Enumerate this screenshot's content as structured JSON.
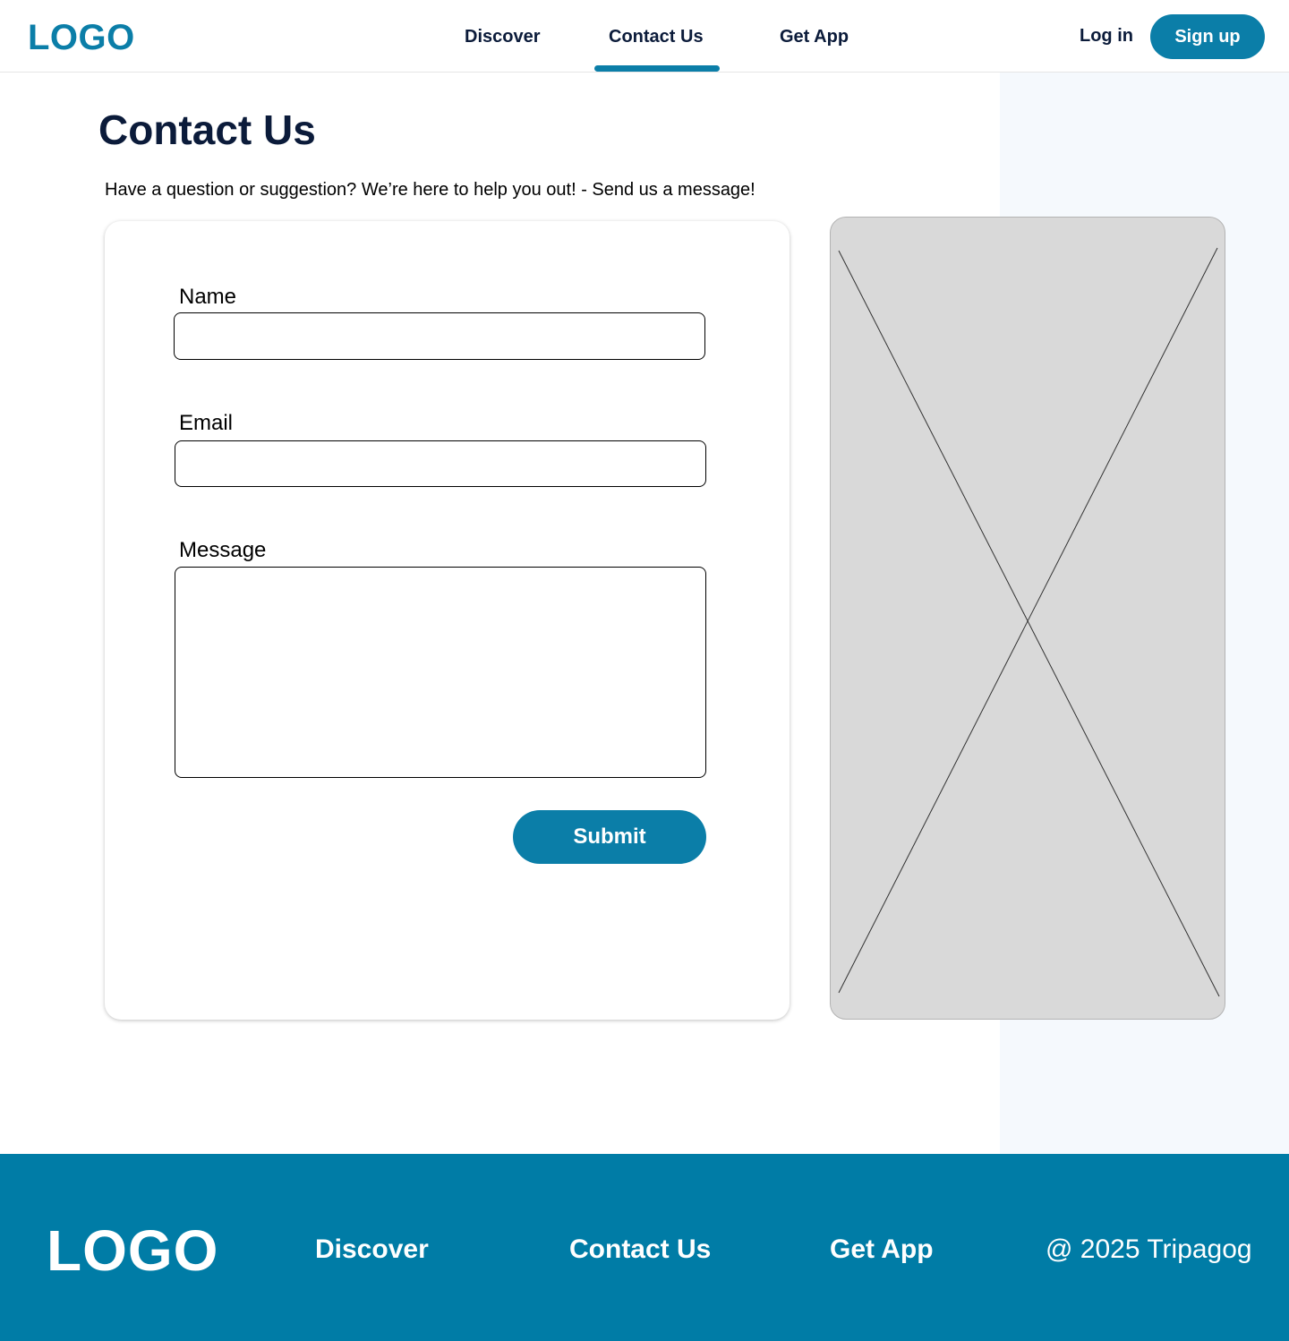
{
  "header": {
    "logo": "LOGO",
    "nav": [
      {
        "label": "Discover",
        "active": false
      },
      {
        "label": "Contact Us",
        "active": true
      },
      {
        "label": "Get App",
        "active": false
      }
    ],
    "login_label": "Log in",
    "signup_label": "Sign up"
  },
  "main": {
    "title": "Contact Us",
    "subtitle": "Have a question or suggestion? We’re here to help you out! - Send us a message!",
    "form": {
      "name_label": "Name",
      "name_value": "",
      "email_label": "Email",
      "email_value": "",
      "message_label": "Message",
      "message_value": "",
      "submit_label": "Submit"
    },
    "image_placeholder": "image-placeholder-icon"
  },
  "footer": {
    "logo": "LOGO",
    "links": [
      "Discover",
      "Contact Us",
      "Get App"
    ],
    "copyright": "@ 2025 Tripagog"
  },
  "colors": {
    "accent": "#0b7ea8",
    "footer_bg": "#007ca6",
    "text_dark": "#0b1b3a",
    "side_panel": "#f5f9fd",
    "placeholder_gray": "#d9d9d9"
  }
}
